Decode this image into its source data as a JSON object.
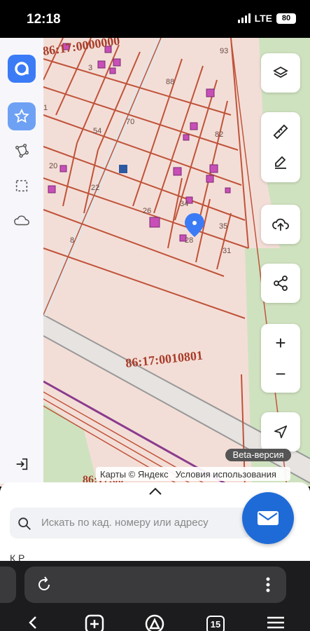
{
  "status_bar": {
    "time": "12:18",
    "network": "LTE",
    "battery": "80"
  },
  "map": {
    "cadastral_numbers": [
      "86:17:0000000",
      "86:17:0010801",
      "86:17:00"
    ],
    "lot_labels": [
      "93",
      "88",
      "54",
      "70",
      "82",
      "20",
      "22",
      "26",
      "34",
      "35",
      "31",
      "28",
      "8",
      "3",
      "1"
    ],
    "beta_label": "Beta-версия",
    "attribution": "Карты © Яндекс",
    "terms_link": "Условия использования"
  },
  "sidebar": {
    "logo": "app-logo",
    "items": [
      {
        "icon": "star-icon"
      },
      {
        "icon": "polygon-icon"
      },
      {
        "icon": "select-area-icon"
      },
      {
        "icon": "cloud-icon"
      }
    ],
    "logout_icon": "logout-icon"
  },
  "controls": {
    "layers": "layers-icon",
    "ruler": "ruler-icon",
    "edit": "edit-icon",
    "upload": "upload-icon",
    "share": "share-icon",
    "zoom_in": "+",
    "zoom_out": "−",
    "locate": "navigation-icon"
  },
  "sheet": {
    "search_placeholder": "Искать по кад. номеру или адресу",
    "partial_text": "К                         Р"
  },
  "browser": {
    "tab_count": "15"
  },
  "colors": {
    "accent": "#3b7bf6",
    "fab": "#1e6bd8",
    "parcel_line": "#c0533a",
    "map_bg": "#f3ded7"
  }
}
